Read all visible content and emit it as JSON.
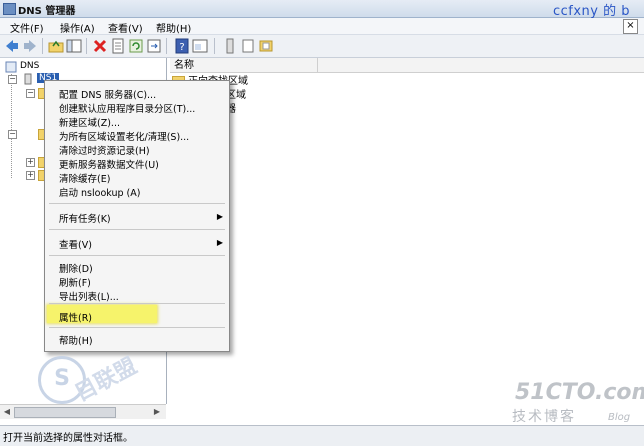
{
  "window": {
    "title": "DNS 管理器",
    "watermark_top": "ccfxny 的 b"
  },
  "menubar": {
    "items": [
      {
        "label": "文件(F)"
      },
      {
        "label": "操作(A)"
      },
      {
        "label": "查看(V)"
      },
      {
        "label": "帮助(H)"
      }
    ],
    "close_label": "×"
  },
  "tree": {
    "root": "DNS",
    "server": "NS1"
  },
  "list": {
    "column_header": "名称",
    "rows": [
      {
        "label": "正向查找区域"
      },
      {
        "label": "区域"
      },
      {
        "label": "器"
      }
    ]
  },
  "context_menu": {
    "group1": [
      "配置 DNS 服务器(C)...",
      "创建默认应用程序目录分区(T)...",
      "新建区域(Z)...",
      "为所有区域设置老化/清理(S)...",
      "清除过时资源记录(H)",
      "更新服务器数据文件(U)",
      "清除缓存(E)",
      "启动 nslookup (A)"
    ],
    "all_tasks": "所有任务(K)",
    "view": "查看(V)",
    "group3": [
      "删除(D)",
      "刷新(F)",
      "导出列表(L)..."
    ],
    "properties": "属性(R)",
    "help": "帮助(H)",
    "submenu_arrow": "▶"
  },
  "statusbar": {
    "text": "打开当前选择的属性对话框。"
  },
  "watermarks": {
    "site": "51CTO.com",
    "subtitle": "技术博客",
    "blog": "Blog",
    "circle": "S",
    "stamp": "目联盟"
  },
  "colors": {
    "highlight": "#f6f36b",
    "selection": "#2a5fb0",
    "folder": "#f2d36b"
  }
}
